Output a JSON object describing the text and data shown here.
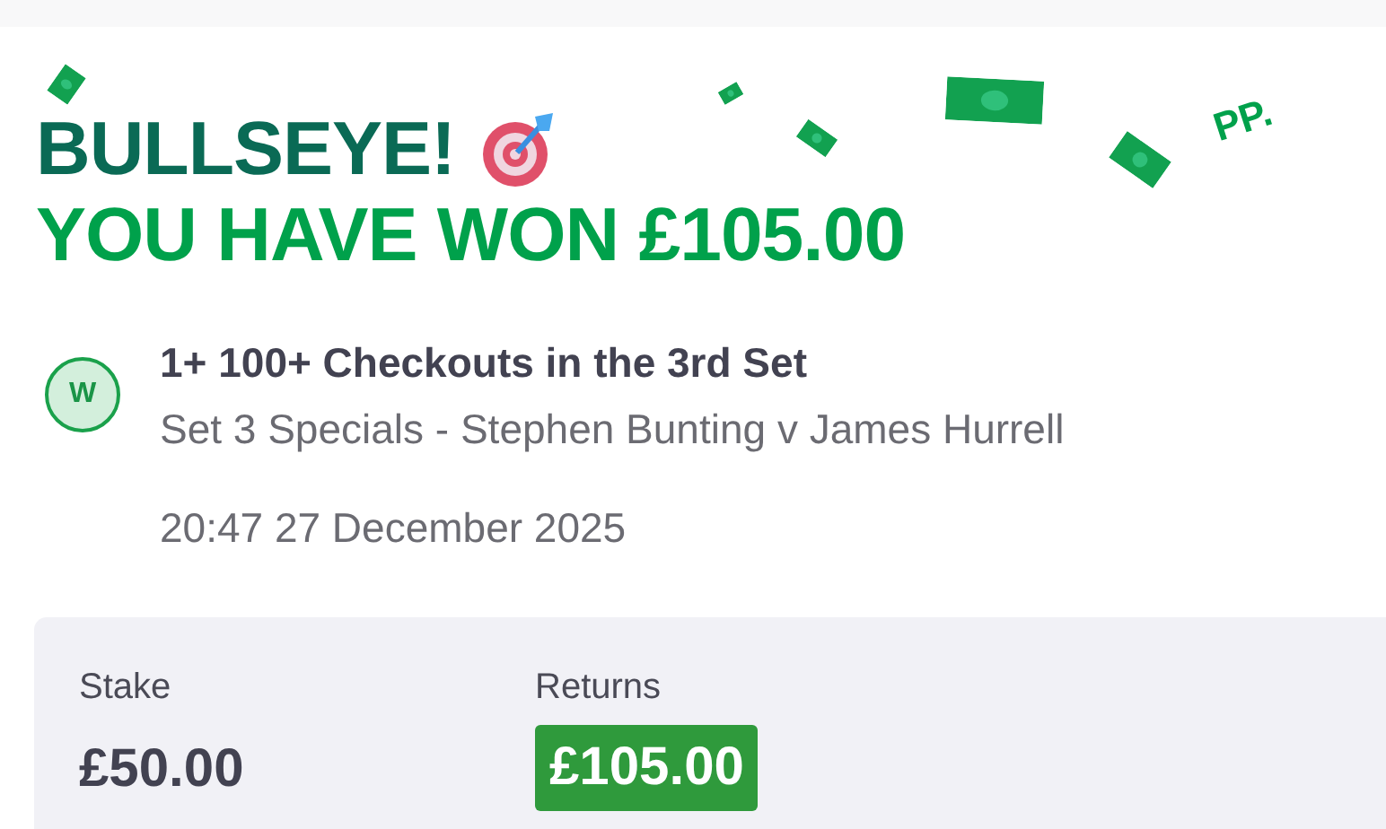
{
  "banner": {
    "headline": "BULLSEYE!",
    "subheadline": "YOU HAVE WON £105.00",
    "logo": "PP."
  },
  "bet": {
    "result": "W",
    "selection": "1+ 100+ Checkouts in the 3rd Set",
    "market": "Set 3 Specials - Stephen Bunting v James Hurrell",
    "placed": "20:47 27 December 2025"
  },
  "summary": {
    "stake_label": "Stake",
    "stake": "£50.00",
    "returns_label": "Returns",
    "returns": "£105.00"
  }
}
